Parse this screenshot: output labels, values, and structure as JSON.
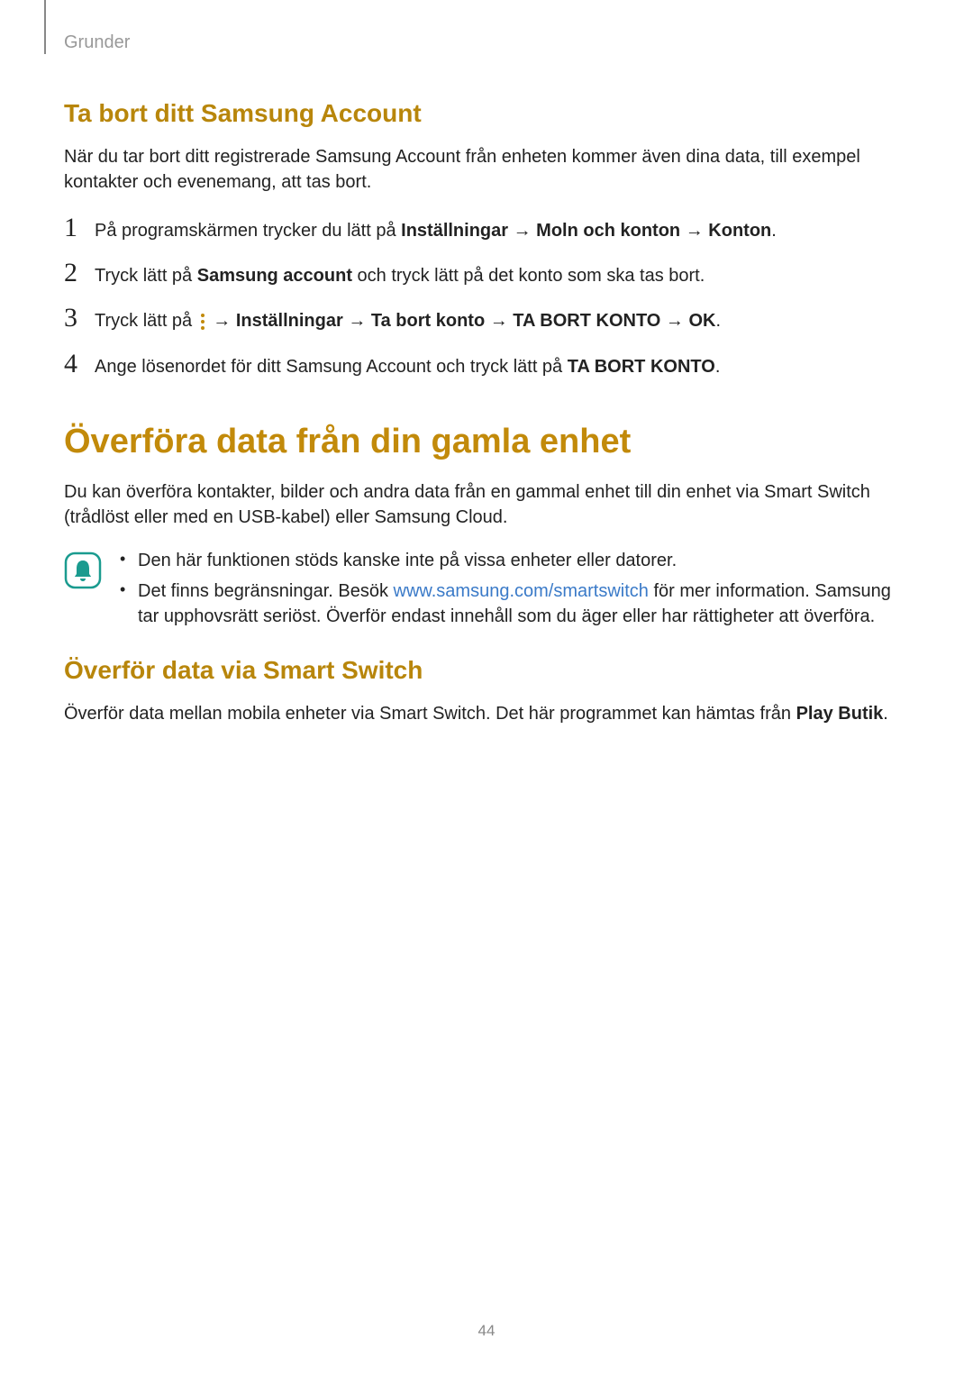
{
  "header": {
    "label": "Grunder"
  },
  "section1": {
    "heading": "Ta bort ditt Samsung Account",
    "intro": "När du tar bort ditt registrerade Samsung Account från enheten kommer även dina data, till exempel kontakter och evenemang, att tas bort.",
    "steps": {
      "s1_a": "På programskärmen trycker du lätt på ",
      "s1_b": "Inställningar",
      "s1_c": " → ",
      "s1_d": "Moln och konton",
      "s1_e": " → ",
      "s1_f": "Konton",
      "s1_g": ".",
      "s2_a": "Tryck lätt på ",
      "s2_b": "Samsung account",
      "s2_c": " och tryck lätt på det konto som ska tas bort.",
      "s3_a": "Tryck lätt på ",
      "s3_b": " → ",
      "s3_c": "Inställningar",
      "s3_d": " → ",
      "s3_e": "Ta bort konto",
      "s3_f": " → ",
      "s3_g": "TA BORT KONTO",
      "s3_h": " → ",
      "s3_i": "OK",
      "s3_j": ".",
      "s4_a": "Ange lösenordet för ditt Samsung Account och tryck lätt på ",
      "s4_b": "TA BORT KONTO",
      "s4_c": "."
    }
  },
  "h1": "Överföra data från din gamla enhet",
  "intro2": "Du kan överföra kontakter, bilder och andra data från en gammal enhet till din enhet via Smart Switch (trådlöst eller med en USB-kabel) eller Samsung Cloud.",
  "note": {
    "b1": "Den här funktionen stöds kanske inte på vissa enheter eller datorer.",
    "b2a": "Det finns begränsningar. Besök ",
    "b2link": "www.samsung.com/smartswitch",
    "b2b": " för mer information. Samsung tar upphovsrätt seriöst. Överför endast innehåll som du äger eller har rättigheter att överföra."
  },
  "section2": {
    "heading": "Överför data via Smart Switch",
    "p_a": "Överför data mellan mobila enheter via Smart Switch. Det här programmet kan hämtas från ",
    "p_b": "Play Butik",
    "p_c": "."
  },
  "pageNumber": "44"
}
